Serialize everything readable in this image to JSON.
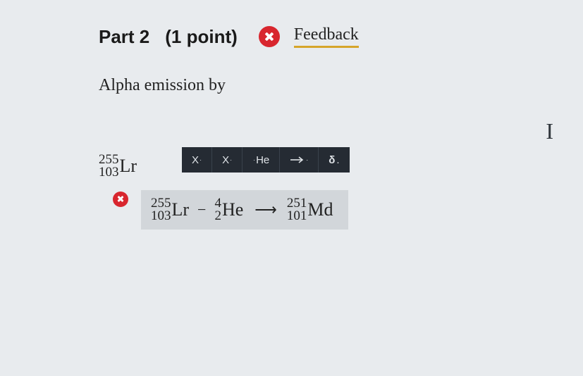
{
  "header": {
    "part_label": "Part 2",
    "points_label": "(1 point)",
    "feedback_label": "Feedback"
  },
  "question": {
    "prompt_text": "Alpha emission by",
    "isotope": {
      "mass": "255",
      "atomic": "103",
      "symbol": "Lr"
    }
  },
  "toolbar": {
    "sup": "X",
    "sub": "X",
    "element_btn": "He",
    "delta_btn": "δ"
  },
  "answer": {
    "term1": {
      "mass": "255",
      "atomic": "103",
      "symbol": "Lr"
    },
    "minus": "−",
    "term2": {
      "mass": "4",
      "atomic": "2",
      "symbol": "He"
    },
    "arrow": "⟶",
    "term3": {
      "mass": "251",
      "atomic": "101",
      "symbol": "Md"
    }
  },
  "cursor_glyph": "I"
}
